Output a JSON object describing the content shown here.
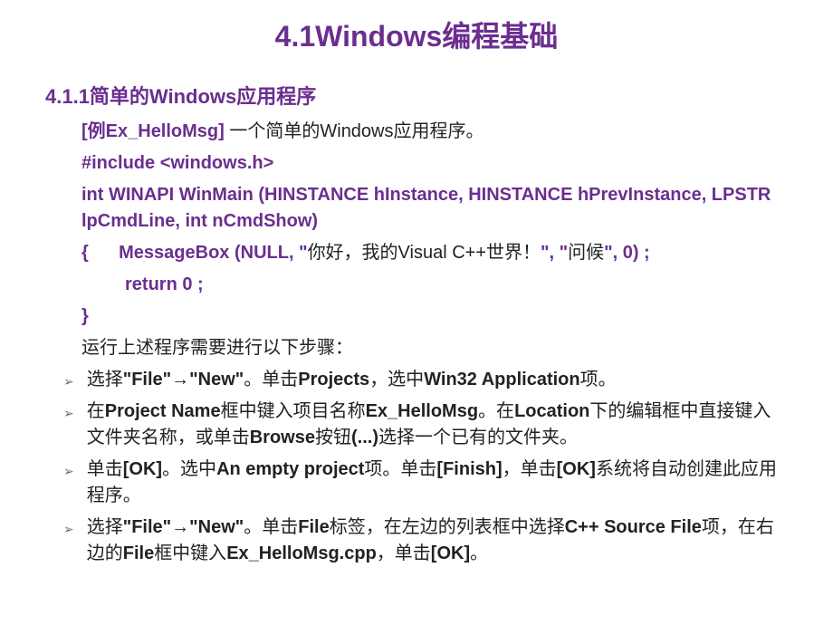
{
  "title": "4.1Windows编程基础",
  "section_heading": "4.1.1简单的Windows应用程序",
  "example_label": "[例Ex_HelloMsg]",
  "example_desc": " 一个简单的Windows应用程序。",
  "code": {
    "include": "#include <windows.h>",
    "winmain": "int WINAPI WinMain (HINSTANCE hInstance, HINSTANCE hPrevInstance, LPSTR lpCmdLine, int nCmdShow)",
    "brace_open": "{",
    "msgbox_pre": "MessageBox (NULL, \"",
    "msgbox_text": "你好，我的Visual C++世界！",
    "msgbox_post": "\", \"",
    "msgbox_caption": "问候",
    "msgbox_end": "\", 0) ;",
    "return": "return 0 ;",
    "brace_close": "}"
  },
  "steps_intro": "运行上述程序需要进行以下步骤：",
  "bullets": [
    {
      "parts": [
        {
          "text": "选择",
          "bold": false
        },
        {
          "text": "\"File\"",
          "bold": true
        },
        {
          "text": "→",
          "bold": false,
          "arrow": true
        },
        {
          "text": "\"New\"",
          "bold": true
        },
        {
          "text": "。单击",
          "bold": false
        },
        {
          "text": "Projects",
          "bold": true
        },
        {
          "text": "，选中",
          "bold": false
        },
        {
          "text": "Win32 Application",
          "bold": true
        },
        {
          "text": "项。",
          "bold": false
        }
      ]
    },
    {
      "parts": [
        {
          "text": "在",
          "bold": false
        },
        {
          "text": "Project Name",
          "bold": true
        },
        {
          "text": "框中键入项目名称",
          "bold": false
        },
        {
          "text": "Ex_HelloMsg",
          "bold": true
        },
        {
          "text": "。在",
          "bold": false
        },
        {
          "text": "Location",
          "bold": true
        },
        {
          "text": "下的编辑框中直接键入文件夹名称，或单击",
          "bold": false
        },
        {
          "text": "Browse",
          "bold": true
        },
        {
          "text": "按钮",
          "bold": false
        },
        {
          "text": "(...)",
          "bold": true
        },
        {
          "text": "选择一个已有的文件夹。",
          "bold": false
        }
      ]
    },
    {
      "parts": [
        {
          "text": "单击",
          "bold": false
        },
        {
          "text": "[OK]",
          "bold": true
        },
        {
          "text": "。选中",
          "bold": false
        },
        {
          "text": "An empty project",
          "bold": true
        },
        {
          "text": "项。单击",
          "bold": false
        },
        {
          "text": "[Finish]",
          "bold": true
        },
        {
          "text": "，单击",
          "bold": false
        },
        {
          "text": "[OK]",
          "bold": true
        },
        {
          "text": "系统将自动创建此应用程序。",
          "bold": false
        }
      ]
    },
    {
      "parts": [
        {
          "text": "选择",
          "bold": false
        },
        {
          "text": "\"File\"",
          "bold": true
        },
        {
          "text": "→",
          "bold": false,
          "arrow": true
        },
        {
          "text": "\"New\"",
          "bold": true
        },
        {
          "text": "。单击",
          "bold": false
        },
        {
          "text": "File",
          "bold": true
        },
        {
          "text": "标签，在左边的列表框中选择",
          "bold": false
        },
        {
          "text": "C++ Source File",
          "bold": true
        },
        {
          "text": "项，在右边的",
          "bold": false
        },
        {
          "text": "File",
          "bold": true
        },
        {
          "text": "框中键入",
          "bold": false
        },
        {
          "text": "Ex_HelloMsg.cpp",
          "bold": true
        },
        {
          "text": "，单击",
          "bold": false
        },
        {
          "text": "[OK]",
          "bold": true
        },
        {
          "text": "。",
          "bold": false
        }
      ]
    }
  ]
}
